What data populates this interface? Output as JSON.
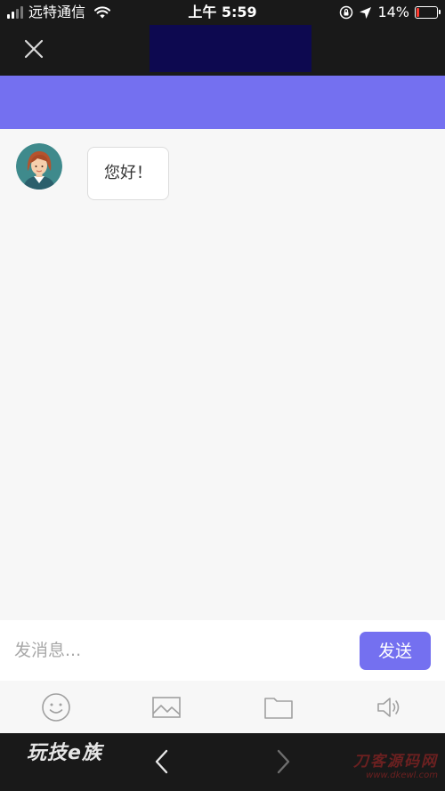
{
  "status_bar": {
    "carrier": "远特通信",
    "time": "上午 5:59",
    "battery_percent": "14%",
    "battery_level": 0.14
  },
  "header": {
    "close_icon": "close-icon"
  },
  "chat": {
    "messages": [
      {
        "sender": "agent",
        "avatar": "avatar-female-agent",
        "text": "您好！"
      }
    ]
  },
  "composer": {
    "placeholder": "发消息...",
    "send_label": "发送"
  },
  "toolbar": {
    "icons": [
      "emoji-icon",
      "image-icon",
      "folder-icon",
      "speaker-icon"
    ]
  },
  "browser_bar": {
    "brand": "玩技e族",
    "back_icon": "chevron-left-icon",
    "forward_icon": "chevron-right-icon",
    "watermark_main": "刀客源码网",
    "watermark_sub": "www.dkewl.com"
  },
  "colors": {
    "accent": "#7470f0",
    "dark": "#191919",
    "header_block": "#0d0950",
    "chat_bg": "#f7f7f7",
    "battery_low": "#ff3b30"
  }
}
